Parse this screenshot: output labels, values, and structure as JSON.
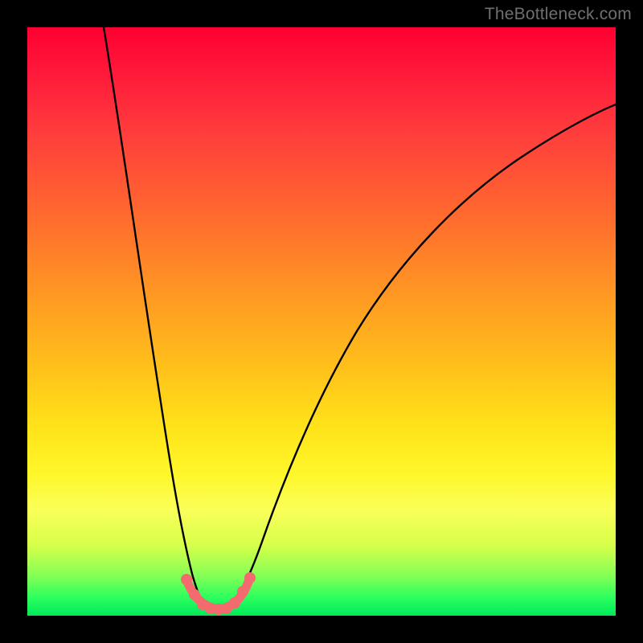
{
  "attribution": "TheBottleneck.com",
  "colors": {
    "frame": "#000000",
    "curve": "#000000",
    "markers": "#f36a6f",
    "gradient_stops": [
      "#ff0030",
      "#ff1a3a",
      "#ff3d3d",
      "#ff6a2e",
      "#ff9a22",
      "#ffc11a",
      "#ffe31a",
      "#fff72a",
      "#faff59",
      "#d7ff4a",
      "#88ff55",
      "#2bff5e",
      "#00e85a"
    ]
  },
  "chart_data": {
    "type": "line",
    "title": "",
    "xlabel": "",
    "ylabel": "",
    "xlim": [
      0,
      100
    ],
    "ylim": [
      0,
      100
    ],
    "grid": false,
    "legend": false,
    "series": [
      {
        "name": "bottleneck-curve",
        "x": [
          13,
          15,
          17,
          19,
          21,
          23,
          25,
          27,
          28.5,
          30,
          32,
          34,
          36,
          40,
          45,
          50,
          55,
          60,
          65,
          70,
          75,
          80,
          85,
          90,
          95,
          100
        ],
        "y": [
          100,
          88,
          75,
          62,
          48,
          34,
          20,
          10,
          4,
          2,
          2,
          4,
          10,
          24,
          38,
          48,
          56,
          62,
          67,
          71,
          74.5,
          77.5,
          80,
          82,
          84,
          85.5
        ]
      }
    ],
    "markers": {
      "name": "bottom-cluster",
      "x": [
        26.5,
        27.8,
        29.0,
        30.2,
        31.5,
        32.8,
        34.0
      ],
      "y": [
        6.0,
        3.2,
        1.8,
        1.5,
        1.8,
        3.2,
        6.0
      ]
    },
    "gradient_sense": "top=100 (red) → bottom=0 (green)"
  }
}
